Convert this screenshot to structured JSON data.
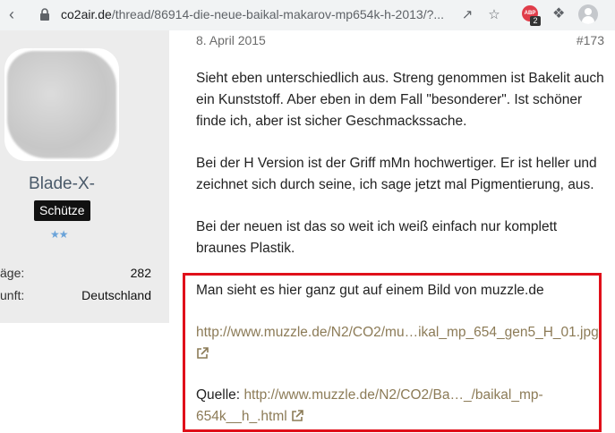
{
  "browser": {
    "url_host": "co2air.de",
    "url_path": "/thread/86914-die-neue-baikal-makarov-mp654k-h-2013/?...",
    "abp_label": "ABP",
    "abp_badge": "2"
  },
  "post": {
    "date": "8. April 2015",
    "number": "#173",
    "paragraphs": [
      "Sieht eben unterschiedlich aus. Streng genommen ist Bakelit auch ein Kunststoff. Aber eben in dem Fall \"besonderer\". Ist schöner finde ich, aber ist sicher Geschmackssache.",
      "Bei der H Version ist der Griff mMn hochwertiger. Er ist heller und zeichnet sich durch seine, ich sage jetzt mal Pigmentierung, aus.",
      "Bei der neuen ist das so weit ich weiß einfach nur komplett braunes Plastik."
    ],
    "quote_intro": "Man sieht es hier ganz gut auf einem Bild von muzzle.de",
    "image_link": "http://www.muzzle.de/N2/CO2/mu…ikal_mp_654_gen5_H_01.jpg",
    "source_label": "Quelle:",
    "source_link_line1": "http://www.muzzle.de/N2/CO2/Ba…_/baikal_mp-",
    "source_link_line2": "654k__h_.html"
  },
  "author": {
    "name": "Blade-X-",
    "rank": "Schütze",
    "stars": "★★",
    "stats": [
      {
        "label": "äge:",
        "value": "282"
      },
      {
        "label": "unft:",
        "value": "Deutschland"
      }
    ]
  },
  "colors": {
    "highlight_border": "#e0101a",
    "link": "#8c7b57"
  }
}
